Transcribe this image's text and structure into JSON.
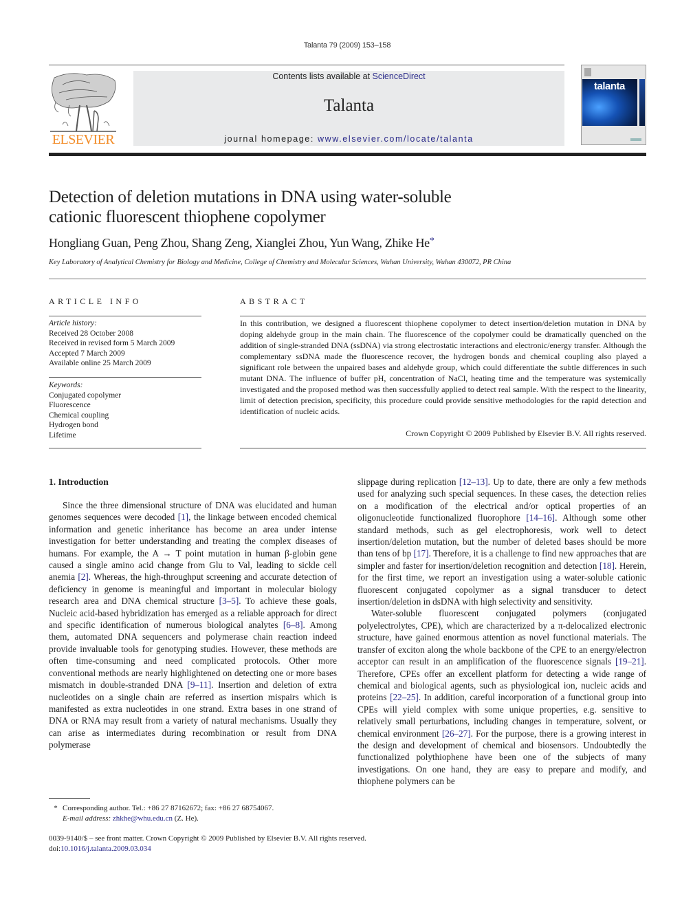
{
  "running_head": "Talanta 79 (2009) 153–158",
  "header": {
    "contents_prefix": "Contents lists available at ",
    "contents_link": "ScienceDirect",
    "journal_title": "Talanta",
    "homepage_prefix": "journal homepage: ",
    "homepage_link": "www.elsevier.com/locate/talanta",
    "publisher_wordmark": "ELSEVIER",
    "cover_title": "talanta",
    "publisher_color": "#f28c28",
    "link_color": "#2a2a8a"
  },
  "article": {
    "title_line1": "Detection of deletion mutations in DNA using water-soluble",
    "title_line2": "cationic fluorescent thiophene copolymer",
    "authors": "Hongliang Guan, Peng Zhou, Shang Zeng, Xianglei Zhou, Yun Wang, Zhike He",
    "corresponding_mark": "*",
    "affiliation": "Key Laboratory of Analytical Chemistry for Biology and Medicine, College of Chemistry and Molecular Sciences, Wuhan University, Wuhan 430072, PR China"
  },
  "article_info": {
    "heading": "ARTICLE INFO",
    "history_label": "Article history:",
    "history": [
      "Received 28 October 2008",
      "Received in revised form 5 March 2009",
      "Accepted 7 March 2009",
      "Available online 25 March 2009"
    ],
    "keywords_label": "Keywords:",
    "keywords": [
      "Conjugated copolymer",
      "Fluorescence",
      "Chemical coupling",
      "Hydrogen bond",
      "Lifetime"
    ]
  },
  "abstract": {
    "heading": "ABSTRACT",
    "text": "In this contribution, we designed a fluorescent thiophene copolymer to detect insertion/deletion mutation in DNA by doping aldehyde group in the main chain. The fluorescence of the copolymer could be dramatically quenched on the addition of single-stranded DNA (ssDNA) via strong electrostatic interactions and electronic/energy transfer. Although the complementary ssDNA made the fluorescence recover, the hydrogen bonds and chemical coupling also played a significant role between the unpaired bases and aldehyde group, which could differentiate the subtle differences in such mutant DNA. The influence of buffer pH, concentration of NaCl, heating time and the temperature was systemically investigated and the proposed method was then successfully applied to detect real sample. With the respect to the linearity, limit of detection precision, specificity, this procedure could provide sensitive methodologies for the rapid detection and identification of nucleic acids.",
    "copyright": "Crown Copyright © 2009 Published by Elsevier B.V. All rights reserved."
  },
  "introduction": {
    "heading": "1.  Introduction",
    "left_paragraph": [
      {
        "t": "Since the three dimensional structure of DNA was elucidated and human genomes sequences were decoded "
      },
      {
        "ref": "[1]"
      },
      {
        "t": ", the linkage between encoded chemical information and genetic inheritance has become an area under intense investigation for better understanding and treating the complex diseases of humans. For example, the A → T point mutation in human β-globin gene caused a single amino acid change from Glu to Val, leading to sickle cell anemia "
      },
      {
        "ref": "[2]"
      },
      {
        "t": ". Whereas, the high-throughput screening and accurate detection of deficiency in genome is meaningful and important in molecular biology research area and DNA chemical structure "
      },
      {
        "ref": "[3–5]"
      },
      {
        "t": ". To achieve these goals, Nucleic acid-based hybridization has emerged as a reliable approach for direct and specific identification of numerous biological analytes "
      },
      {
        "ref": "[6–8]"
      },
      {
        "t": ". Among them, automated DNA sequencers and polymerase chain reaction indeed provide invaluable tools for genotyping studies. However, these methods are often time-consuming and need complicated protocols. Other more conventional methods are nearly highlightened on detecting one or more bases mismatch in double-stranded DNA "
      },
      {
        "ref": "[9–11]"
      },
      {
        "t": ". Insertion and deletion of extra nucleotides on a single chain are referred as insertion mispairs which is manifested as extra nucleotides in one strand. Extra bases in one strand of DNA or RNA may result from a variety of natural mechanisms. Usually they can arise as intermediates during recombination or result from DNA polymerase"
      }
    ],
    "right_paragraph_1": [
      {
        "t": "slippage during replication "
      },
      {
        "ref": "[12–13]"
      },
      {
        "t": ". Up to date, there are only a few methods used for analyzing such special sequences. In these cases, the detection relies on a modification of the electrical and/or optical properties of an oligonucleotide functionalized fluorophore "
      },
      {
        "ref": "[14–16]"
      },
      {
        "t": ". Although some other standard methods, such as gel electrophoresis, work well to detect insertion/deletion mutation, but the number of deleted bases should be more than tens of bp "
      },
      {
        "ref": "[17]"
      },
      {
        "t": ". Therefore, it is a challenge to find new approaches that are simpler and faster for insertion/deletion recognition and detection "
      },
      {
        "ref": "[18]"
      },
      {
        "t": ". Herein, for the first time, we report an investigation using a water-soluble cationic fluorescent conjugated copolymer as a signal transducer to detect insertion/deletion in dsDNA with high selectivity and sensitivity."
      }
    ],
    "right_paragraph_2": [
      {
        "t": "Water-soluble fluorescent conjugated polymers (conjugated polyelectrolytes, CPE), which are characterized by a π-delocalized electronic structure, have gained enormous attention as novel functional materials. The transfer of exciton along the whole backbone of the CPE to an energy/electron acceptor can result in an amplification of the fluorescence signals "
      },
      {
        "ref": "[19–21]"
      },
      {
        "t": ". Therefore, CPEs offer an excellent platform for detecting a wide range of chemical and biological agents, such as physiological ion, nucleic acids and proteins "
      },
      {
        "ref": "[22–25]"
      },
      {
        "t": ". In addition, careful incorporation of a functional group into CPEs will yield complex with some unique properties, e.g. sensitive to relatively small perturbations, including changes in temperature, solvent, or chemical environment "
      },
      {
        "ref": "[26–27]"
      },
      {
        "t": ". For the purpose, there is a growing interest in the design and development of chemical and biosensors. Undoubtedly the functionalized polythiophene have been one of the subjects of many investigations. On one hand, they are easy to prepare and modify, and thiophene polymers can be"
      }
    ]
  },
  "footnote": {
    "mark": "*",
    "text": "Corresponding author. Tel.: +86 27 87162672; fax: +86 27 68754067.",
    "email_label": "E-mail address:",
    "email": "zhkhe@whu.edu.cn",
    "email_suffix": " (Z. He)."
  },
  "bottom_meta": {
    "issn_line": "0039-9140/$ – see front matter. Crown Copyright © 2009 Published by Elsevier B.V. All rights reserved.",
    "doi_prefix": "doi:",
    "doi": "10.1016/j.talanta.2009.03.034"
  }
}
